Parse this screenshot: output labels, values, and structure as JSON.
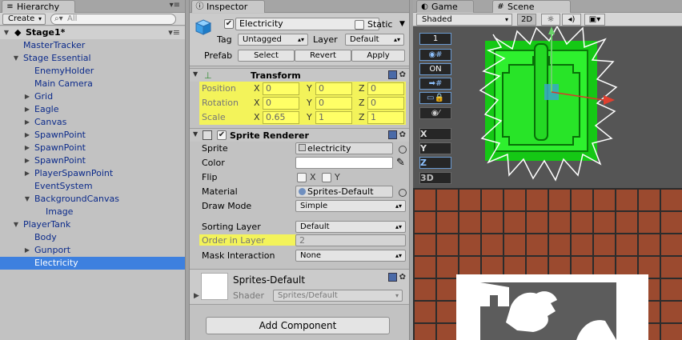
{
  "hierarchy": {
    "tab_label": "Hierarchy",
    "create_label": "Create",
    "search_placeholder": "All",
    "scene_name": "Stage1*",
    "items": [
      {
        "label": "MasterTracker",
        "depth": 1,
        "arrow": ""
      },
      {
        "label": "Stage Essential",
        "depth": 1,
        "arrow": "down"
      },
      {
        "label": "EnemyHolder",
        "depth": 2,
        "arrow": ""
      },
      {
        "label": "Main Camera",
        "depth": 2,
        "arrow": ""
      },
      {
        "label": "Grid",
        "depth": 2,
        "arrow": "right"
      },
      {
        "label": "Eagle",
        "depth": 2,
        "arrow": "right"
      },
      {
        "label": "Canvas",
        "depth": 2,
        "arrow": "right"
      },
      {
        "label": "SpawnPoint",
        "depth": 2,
        "arrow": "right"
      },
      {
        "label": "SpawnPoint",
        "depth": 2,
        "arrow": "right"
      },
      {
        "label": "SpawnPoint",
        "depth": 2,
        "arrow": "right"
      },
      {
        "label": "PlayerSpawnPoint",
        "depth": 2,
        "arrow": "right"
      },
      {
        "label": "EventSystem",
        "depth": 2,
        "arrow": ""
      },
      {
        "label": "BackgroundCanvas",
        "depth": 2,
        "arrow": "down"
      },
      {
        "label": "Image",
        "depth": 3,
        "arrow": ""
      },
      {
        "label": "PlayerTank",
        "depth": 1,
        "arrow": "down"
      },
      {
        "label": "Body",
        "depth": 2,
        "arrow": ""
      },
      {
        "label": "Gunport",
        "depth": 2,
        "arrow": "right"
      },
      {
        "label": "Electricity",
        "depth": 2,
        "arrow": "",
        "selected": true
      }
    ]
  },
  "inspector": {
    "tab_label": "Inspector",
    "object_name": "Electricity",
    "static_label": "Static",
    "tag_label": "Tag",
    "tag_value": "Untagged",
    "layer_label": "Layer",
    "layer_value": "Default",
    "prefab_label": "Prefab",
    "select_label": "Select",
    "revert_label": "Revert",
    "apply_label": "Apply",
    "transform": {
      "title": "Transform",
      "position": {
        "label": "Position",
        "x": "0",
        "y": "0",
        "z": "0"
      },
      "rotation": {
        "label": "Rotation",
        "x": "0",
        "y": "0",
        "z": "0"
      },
      "scale": {
        "label": "Scale",
        "x": "0.65",
        "y": "1",
        "z": "1"
      }
    },
    "sprite_renderer": {
      "title": "Sprite Renderer",
      "sprite_label": "Sprite",
      "sprite_value": "electricity",
      "color_label": "Color",
      "flip_label": "Flip",
      "flip_x": "X",
      "flip_y": "Y",
      "material_label": "Material",
      "material_value": "Sprites-Default",
      "draw_mode_label": "Draw Mode",
      "draw_mode_value": "Simple",
      "sorting_layer_label": "Sorting Layer",
      "sorting_layer_value": "Default",
      "order_label": "Order in Layer",
      "order_value": "2",
      "mask_label": "Mask Interaction",
      "mask_value": "None"
    },
    "material": {
      "name": "Sprites-Default",
      "shader_label": "Shader",
      "shader_value": "Sprites/Default"
    },
    "add_component_label": "Add Component"
  },
  "scene": {
    "game_tab": "Game",
    "scene_tab": "Scene",
    "shading_mode": "Shaded",
    "mode_2d": "2D",
    "layer_number": "1",
    "on_label": "ON",
    "axis_x": "X",
    "axis_y": "Y",
    "axis_z": "Z",
    "view_3d": "3D"
  },
  "colors": {
    "selection": "#3d80df",
    "highlight": "#f3f35a",
    "hierarchy_text": "#0b2a8a",
    "sprite_green": "#1fd61f",
    "brick": "#9b4a2f"
  }
}
